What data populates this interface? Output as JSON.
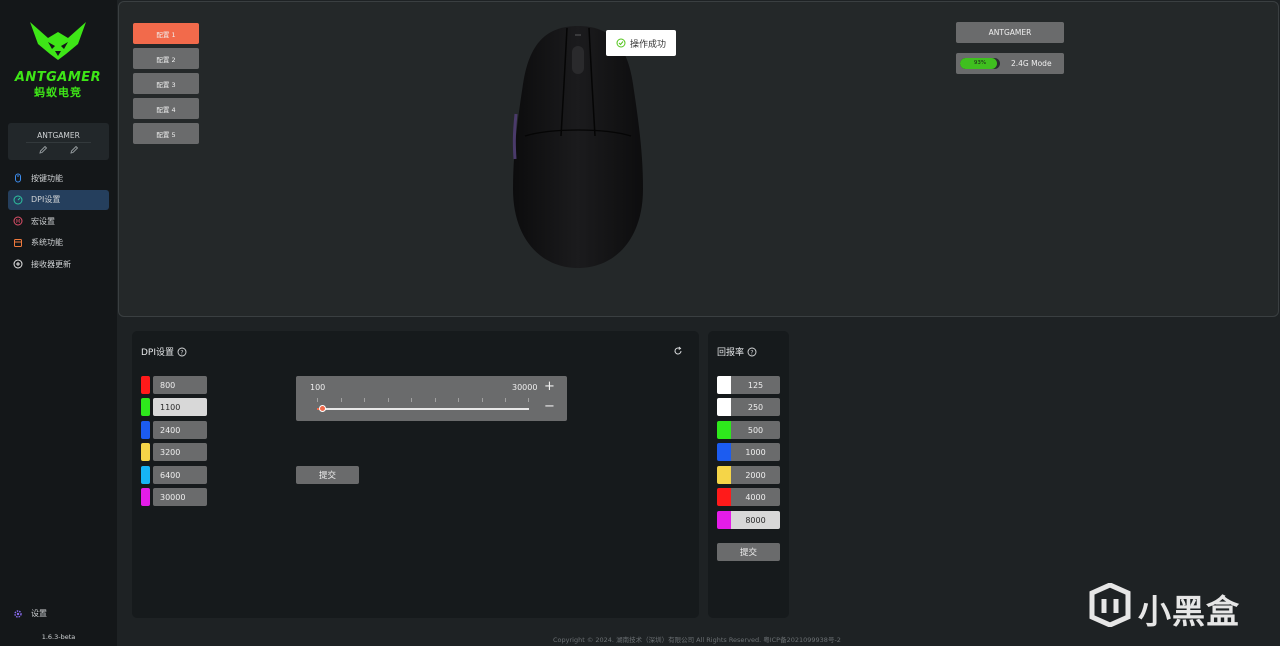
{
  "sidebar": {
    "brand": "ANTGAMER",
    "brand_sub": "蚂蚁电竞",
    "device_name": "ANTGAMER",
    "nav": [
      {
        "label": "按键功能",
        "icon": "mouse-icon"
      },
      {
        "label": "DPI设置",
        "icon": "gauge-icon"
      },
      {
        "label": "宏设置",
        "icon": "macro-icon"
      },
      {
        "label": "系统功能",
        "icon": "calendar-icon"
      },
      {
        "label": "接收器更新",
        "icon": "update-icon"
      }
    ],
    "active_nav": "DPI设置",
    "settings_label": "设置",
    "version": "1.6.3-beta"
  },
  "profiles": [
    "配置 1",
    "配置 2",
    "配置 3",
    "配置 4",
    "配置 5"
  ],
  "active_profile": "配置 1",
  "toast": {
    "message": "操作成功"
  },
  "device": {
    "brand_button": "ANTGAMER",
    "battery_percent": "93%",
    "battery_level": 0.93,
    "mode": "2.4G Mode"
  },
  "dpi": {
    "title": "DPI设置",
    "stages": [
      {
        "value": "800",
        "color": "#ff1a1a"
      },
      {
        "value": "1100",
        "color": "#2ee81c"
      },
      {
        "value": "2400",
        "color": "#1c5cf0"
      },
      {
        "value": "3200",
        "color": "#f5d548"
      },
      {
        "value": "6400",
        "color": "#16b4f5"
      },
      {
        "value": "30000",
        "color": "#e41ce8"
      }
    ],
    "active_stage": "1100",
    "slider_min": "100",
    "slider_max": "30000",
    "slider_value": 100,
    "submit_label": "提交"
  },
  "polling": {
    "title": "回报率",
    "rates": [
      {
        "value": "125",
        "color": "#ffffff"
      },
      {
        "value": "250",
        "color": "#ffffff"
      },
      {
        "value": "500",
        "color": "#2ee81c"
      },
      {
        "value": "1000",
        "color": "#1c5cf0"
      },
      {
        "value": "2000",
        "color": "#f5d548"
      },
      {
        "value": "4000",
        "color": "#ff1a1a"
      },
      {
        "value": "8000",
        "color": "#e41ce8"
      }
    ],
    "active_rate": "8000",
    "submit_label": "提交"
  },
  "footer": "Copyright © 2024. 湖南技术（深圳）有限公司 All Rights Reserved. 粤ICP备2021099938号-2",
  "watermark": "小黑盒",
  "colors": {
    "accent": "#f26a4b",
    "brand_green": "#3ee617",
    "active_nav_bg": "#253f5d"
  }
}
